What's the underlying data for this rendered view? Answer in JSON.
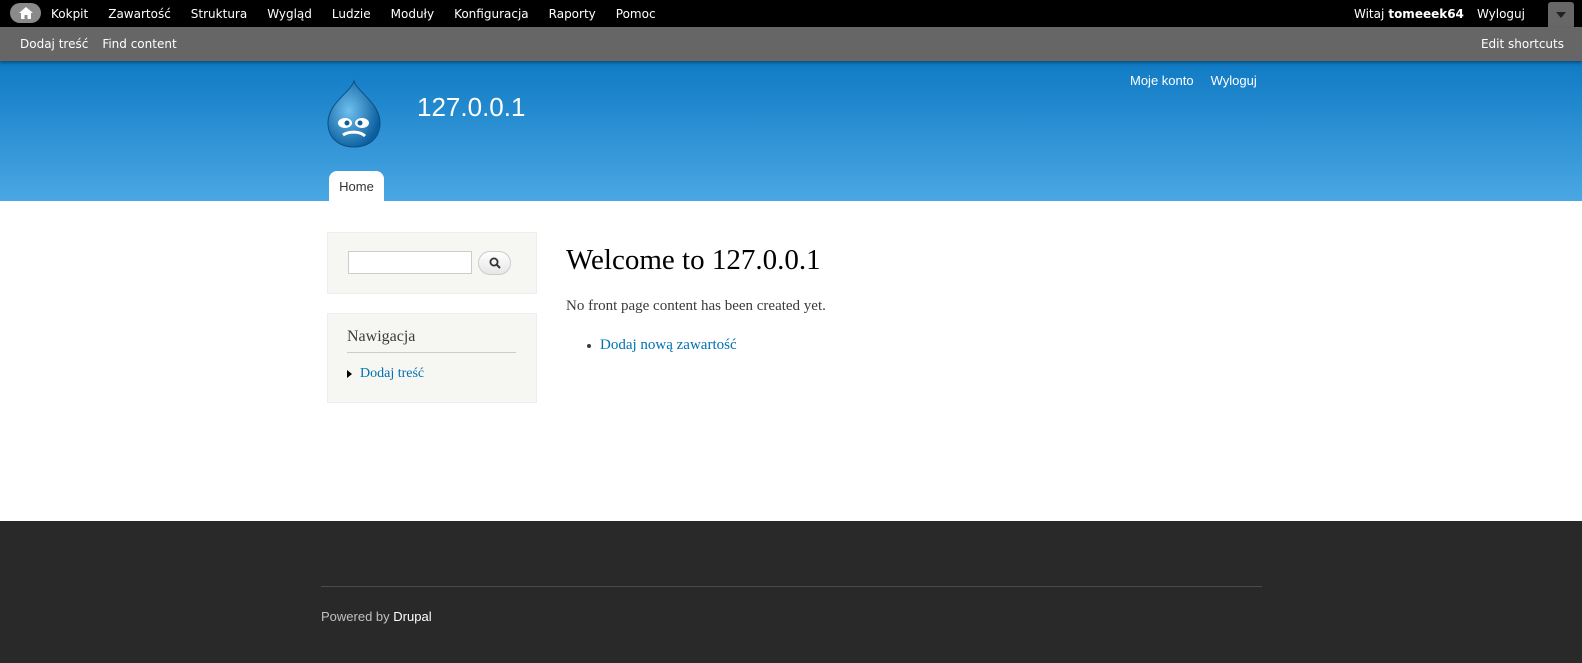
{
  "toolbar": {
    "menu": [
      "Kokpit",
      "Zawartość",
      "Struktura",
      "Wygląd",
      "Ludzie",
      "Moduły",
      "Konfiguracja",
      "Raporty",
      "Pomoc"
    ],
    "welcome": "Witaj",
    "username": "tomeeek64",
    "logout": "Wyloguj"
  },
  "shortcuts": {
    "items": [
      "Dodaj treść",
      "Find content"
    ],
    "edit": "Edit shortcuts"
  },
  "header": {
    "site_name": "127.0.0.1",
    "secondary": [
      "Moje konto",
      "Wyloguj"
    ],
    "tab_home": "Home"
  },
  "sidebar": {
    "nav_title": "Nawigacja",
    "nav_item": "Dodaj treść"
  },
  "main": {
    "title": "Welcome to 127.0.0.1",
    "text": "No front page content has been created yet.",
    "link": "Dodaj nową zawartość"
  },
  "footer": {
    "powered_by": "Powered by",
    "drupal": "Drupal"
  },
  "colors": {
    "header_top": "#0f7ac4",
    "header_bottom": "#4aa7e3",
    "link": "#0071b3",
    "footer_bg": "#292929"
  }
}
